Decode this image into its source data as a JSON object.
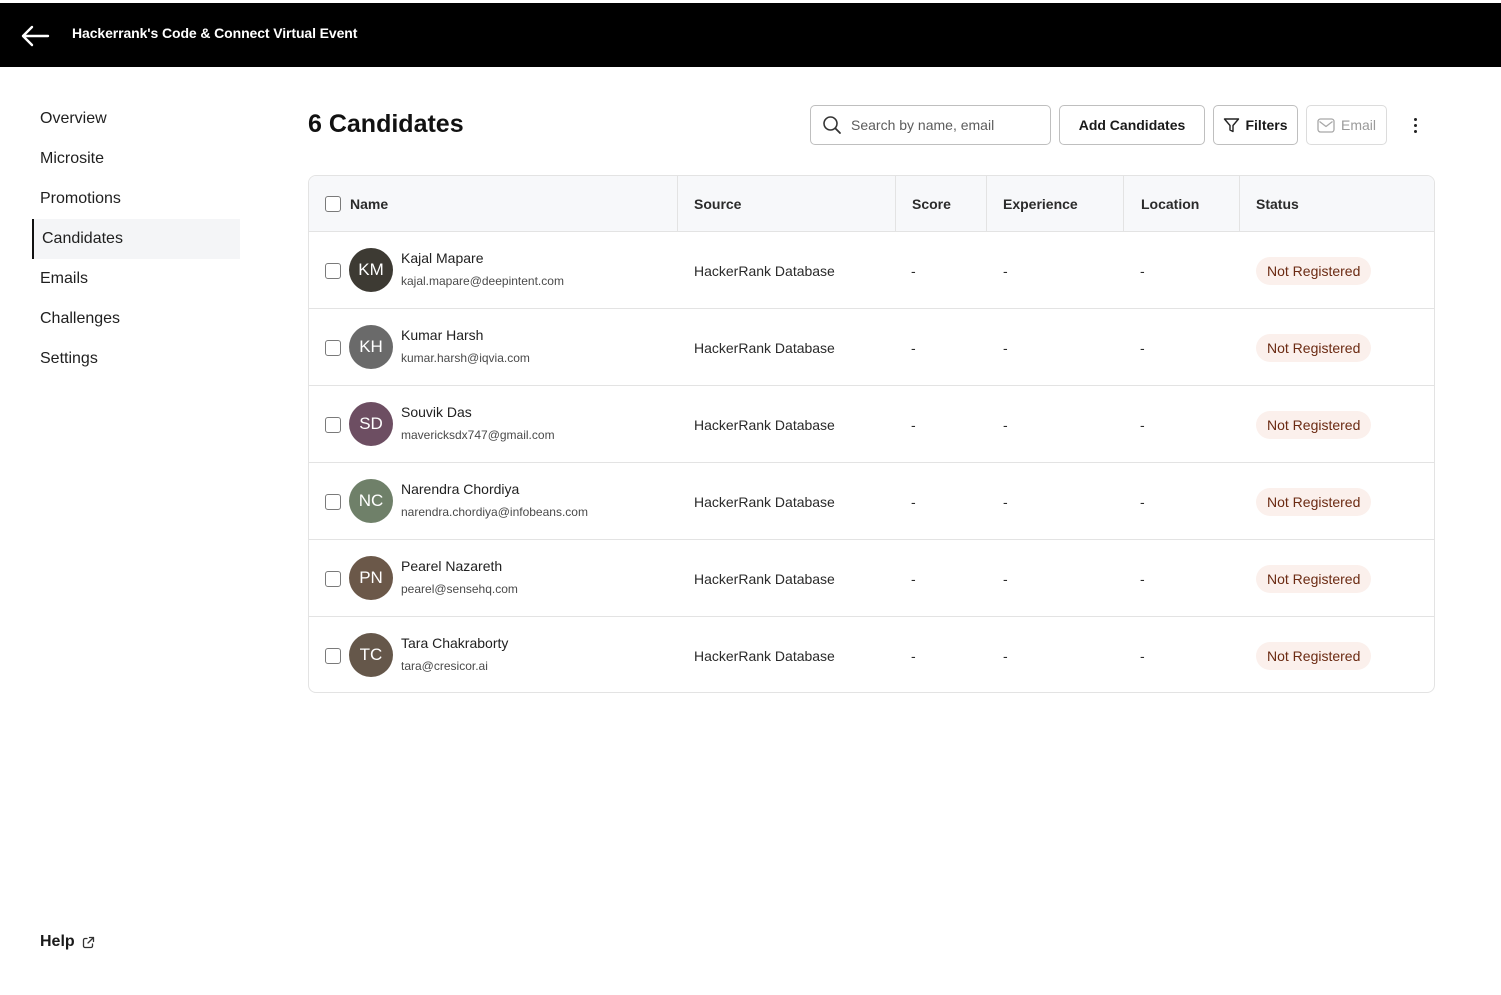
{
  "header": {
    "title": "Hackerrank's Code & Connect Virtual Event"
  },
  "sidebar": {
    "items": [
      {
        "label": "Overview",
        "active": false
      },
      {
        "label": "Microsite",
        "active": false
      },
      {
        "label": "Promotions",
        "active": false
      },
      {
        "label": "Candidates",
        "active": true
      },
      {
        "label": "Emails",
        "active": false
      },
      {
        "label": "Challenges",
        "active": false
      },
      {
        "label": "Settings",
        "active": false
      }
    ],
    "help_label": "Help"
  },
  "main": {
    "title": "6 Candidates",
    "search": {
      "placeholder": "Search by name, email",
      "value": ""
    },
    "buttons": {
      "add": "Add Candidates",
      "filters": "Filters",
      "email": "Email"
    },
    "columns": [
      "Name",
      "Source",
      "Score",
      "Experience",
      "Location",
      "Status"
    ],
    "rows": [
      {
        "initials": "KM",
        "avatar_color": "#3d3a33",
        "name": "Kajal Mapare",
        "email": "kajal.mapare@deepintent.com",
        "source": "HackerRank Database",
        "score": "-",
        "experience": "-",
        "location": "-",
        "status": "Not Registered"
      },
      {
        "initials": "KH",
        "avatar_color": "#6a6a6a",
        "name": "Kumar Harsh",
        "email": "kumar.harsh@iqvia.com",
        "source": "HackerRank Database",
        "score": "-",
        "experience": "-",
        "location": "-",
        "status": "Not Registered"
      },
      {
        "initials": "SD",
        "avatar_color": "#6d4e62",
        "name": "Souvik Das",
        "email": "mavericksdx747@gmail.com",
        "source": "HackerRank Database",
        "score": "-",
        "experience": "-",
        "location": "-",
        "status": "Not Registered"
      },
      {
        "initials": "NC",
        "avatar_color": "#6f8069",
        "name": "Narendra Chordiya",
        "email": "narendra.chordiya@infobeans.com",
        "source": "HackerRank Database",
        "score": "-",
        "experience": "-",
        "location": "-",
        "status": "Not Registered"
      },
      {
        "initials": "PN",
        "avatar_color": "#6b5849",
        "name": "Pearel Nazareth",
        "email": "pearel@sensehq.com",
        "source": "HackerRank Database",
        "score": "-",
        "experience": "-",
        "location": "-",
        "status": "Not Registered"
      },
      {
        "initials": "TC",
        "avatar_color": "#65574a",
        "name": "Tara Chakraborty",
        "email": "tara@cresicor.ai",
        "source": "HackerRank Database",
        "score": "-",
        "experience": "-",
        "location": "-",
        "status": "Not Registered"
      }
    ]
  }
}
